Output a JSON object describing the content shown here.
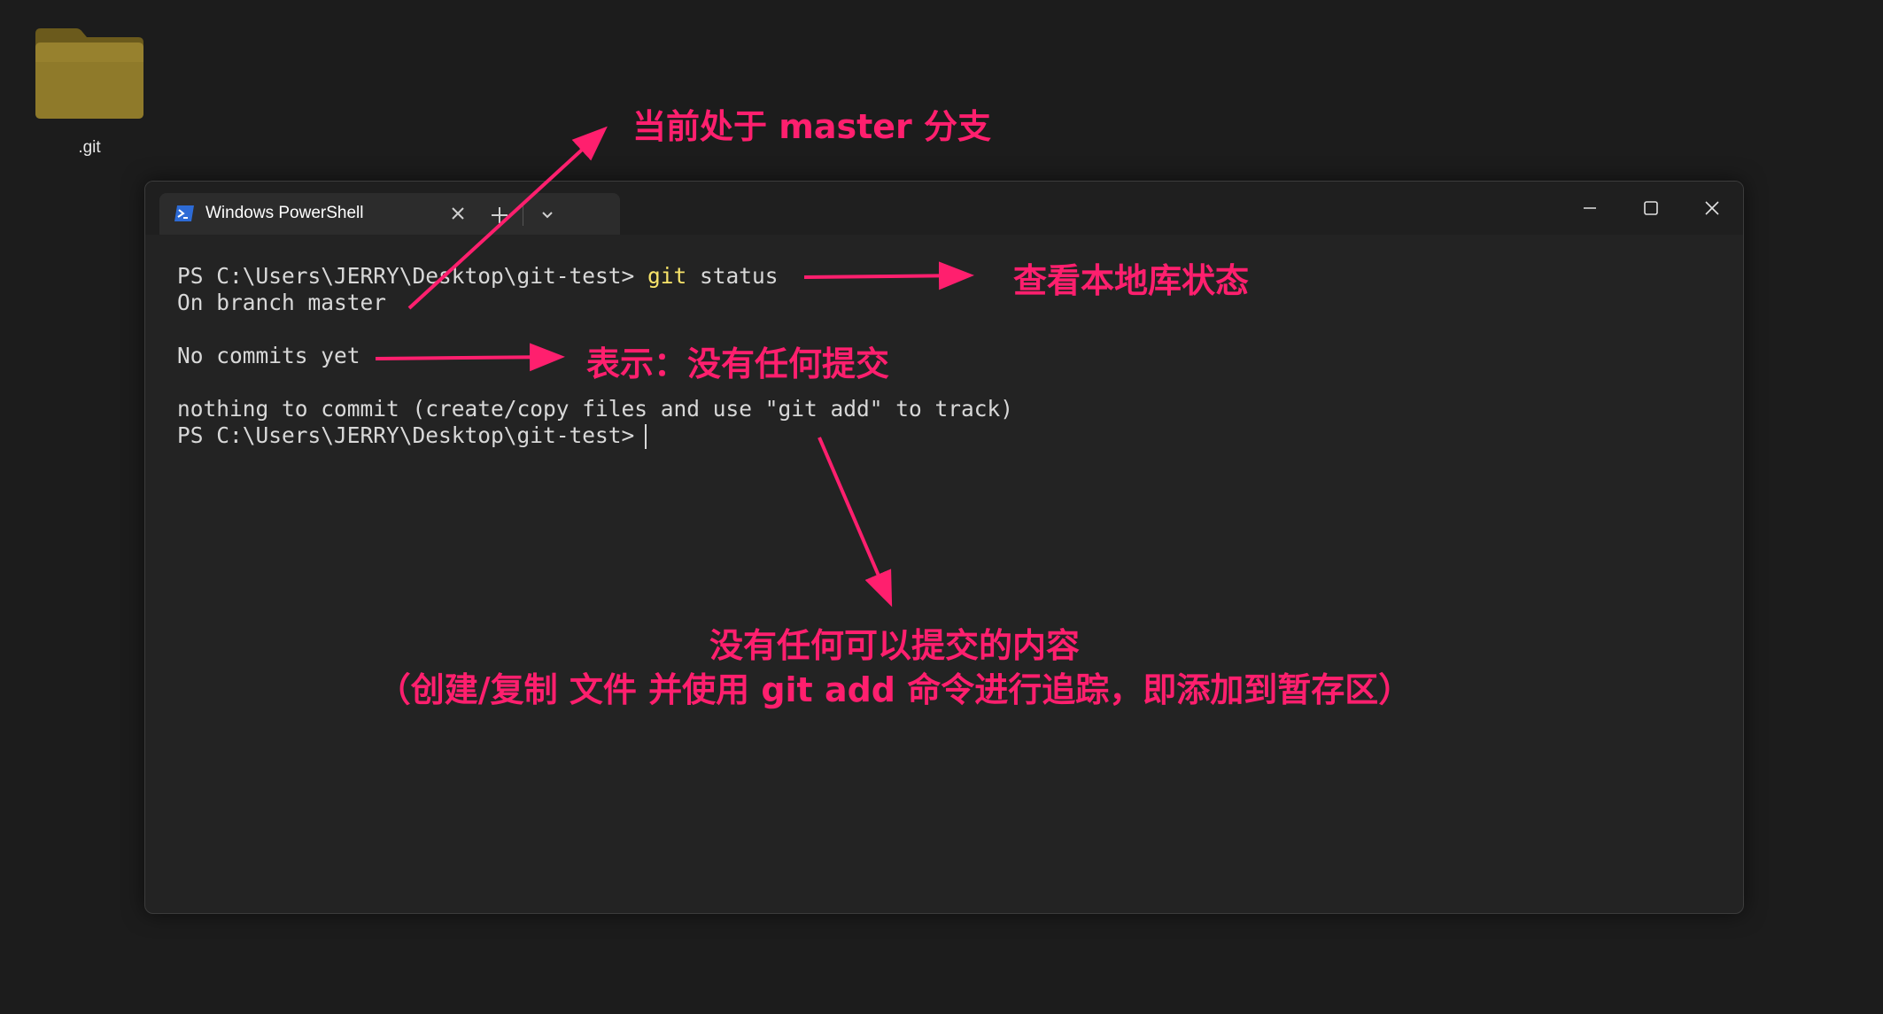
{
  "desktop": {
    "icon": {
      "label": ".git",
      "icon_name": "folder-icon"
    }
  },
  "terminal": {
    "tab": {
      "title": "Windows PowerShell",
      "icon_name": "powershell-icon"
    },
    "lines": {
      "line1_prompt": "PS C:\\Users\\JERRY\\Desktop\\git-test> ",
      "line1_cmd": "git",
      "line1_args": " status",
      "line2": "On branch master",
      "line3": "No commits yet",
      "line4": "nothing to commit (create/copy files and use \"git add\" to track)",
      "line5_prompt": "PS C:\\Users\\JERRY\\Desktop\\git-test>"
    },
    "colors": {
      "background": "#232323",
      "text": "#d8d8d8",
      "command_highlight": "#f7e36a"
    }
  },
  "annotations": {
    "current_branch": "当前处于 master 分支",
    "check_status": "查看本地库状态",
    "no_commits": "表示：没有任何提交",
    "nothing_to_commit_line1": "没有任何可以提交的内容",
    "nothing_to_commit_line2": "（创建/复制 文件 并使用 git add 命令进行追踪，即添加到暂存区）",
    "color": "#ff1f6e"
  }
}
